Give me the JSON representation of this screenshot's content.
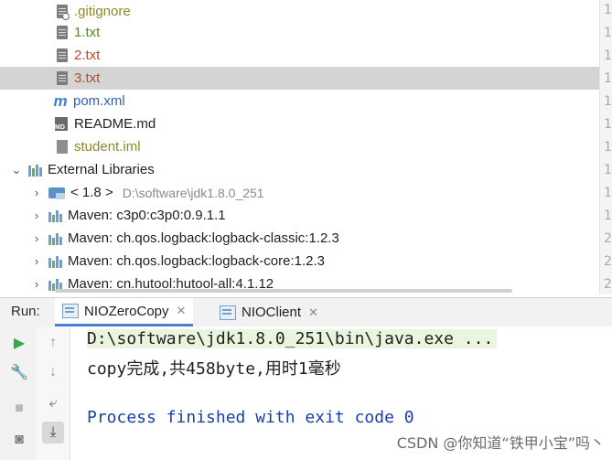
{
  "project_tree": {
    "items": [
      {
        "label": ".gitignore",
        "icon": "gitignore-file-icon",
        "color": "#8a8a2a"
      },
      {
        "label": "1.txt",
        "icon": "text-file-icon",
        "color": "#4b8f1f"
      },
      {
        "label": "2.txt",
        "icon": "text-file-icon",
        "color": "#b44c2a"
      },
      {
        "label": "3.txt",
        "icon": "text-file-icon",
        "color": "#b44c2a",
        "selected": true
      },
      {
        "label": "pom.xml",
        "icon": "maven-icon",
        "color": "#2f5fb5"
      },
      {
        "label": "README.md",
        "icon": "markdown-file-icon",
        "color": "#1f1f1f"
      },
      {
        "label": "student.iml",
        "icon": "iml-file-icon",
        "color": "#8a8a2a"
      }
    ],
    "external_libraries": {
      "label": "External Libraries",
      "expanded": true,
      "children": [
        {
          "label": "< 1.8 >",
          "detail": "D:\\software\\jdk1.8.0_251",
          "icon": "jdk-icon"
        },
        {
          "label": "Maven: c3p0:c3p0:0.9.1.1",
          "icon": "library-icon"
        },
        {
          "label": "Maven: ch.qos.logback:logback-classic:1.2.3",
          "icon": "library-icon"
        },
        {
          "label": "Maven: ch.qos.logback:logback-core:1.2.3",
          "icon": "library-icon"
        },
        {
          "label": "Maven: cn.hutool:hutool-all:4.1.12",
          "icon": "library-icon"
        }
      ]
    }
  },
  "gutter_lines": [
    "1",
    "1",
    "1",
    "1",
    "1",
    "1",
    "1",
    "1",
    "1",
    "1",
    "2",
    "2",
    "2"
  ],
  "run_panel": {
    "label": "Run:",
    "tabs": [
      {
        "label": "NIOZeroCopy",
        "active": true
      },
      {
        "label": "NIOClient",
        "active": false
      }
    ],
    "close_glyph": "✕"
  },
  "console": {
    "lines": [
      {
        "text": "D:\\software\\jdk1.8.0_251\\bin\\java.exe ...",
        "color": "#1f1f1f",
        "highlight": true
      },
      {
        "text": "copy完成,共458byte,用时1毫秒",
        "color": "#1f1f1f"
      },
      {
        "text": "",
        "color": "#1f1f1f"
      },
      {
        "text": "Process finished with exit code 0",
        "color": "#1a3fa8"
      }
    ]
  },
  "watermark": "CSDN @你知道“铁甲小宝”吗丶",
  "colors": {
    "selection": "#d4d4d4",
    "accent": "#4a7fd1",
    "run_green": "#3aa64a"
  }
}
